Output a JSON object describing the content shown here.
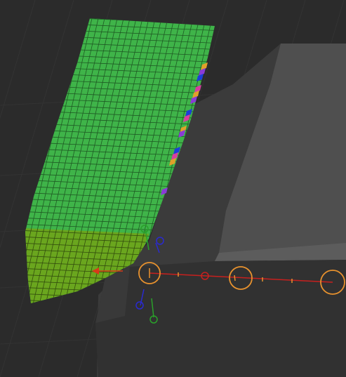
{
  "viewport": {
    "background": "#2b2b2b",
    "grid_color": "#333333"
  },
  "mesh": {
    "fill_color": "#3fb449",
    "wire_color": "#1f5a24",
    "masked_fill_color": "#6aa61e",
    "masked_wire_color": "#334d0e",
    "edge_stripe_colors": [
      "#e0a02a",
      "#8a3bd6",
      "#1c3fd8",
      "#d63fa0"
    ]
  },
  "scene_block": {
    "top_color": "#555555",
    "face_color": "#3c3c3c",
    "front_color": "#2f2f2f"
  },
  "transpose_gizmo": {
    "line_color": "#c8201e",
    "ring_color": "#e8922e",
    "x_axis_color": "#d83a1a",
    "y_axis_color": "#2aa02a",
    "z_axis_color": "#2a2ad0"
  }
}
